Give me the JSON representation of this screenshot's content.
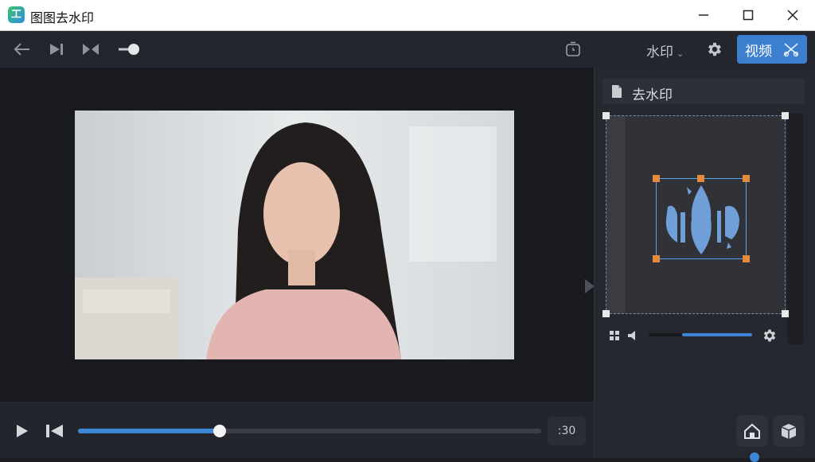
{
  "app": {
    "title": "图图去水印",
    "logo_glyph": "工"
  },
  "window_controls": {
    "minimize": "minimize-icon",
    "maximize": "maximize-icon",
    "close": "close-icon"
  },
  "toolbar": {
    "icons": [
      "back-arrow-icon",
      "skip-forward-icon",
      "split-icon",
      "slider-toggle-icon",
      "timer-icon",
      "gear-icon"
    ],
    "watermark_dropdown": "水印",
    "video_button": "视频"
  },
  "player": {
    "time": ":30",
    "progress": 0.306
  },
  "panel": {
    "title": "去水印",
    "volume": 0.68
  },
  "colors": {
    "accent": "#3d7fcf",
    "handle": "#e58a3c",
    "selection": "#5aa0e6"
  }
}
